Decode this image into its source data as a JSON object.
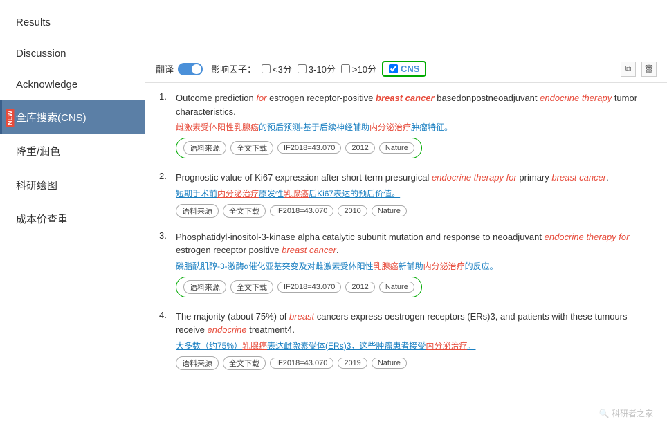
{
  "sidebar": {
    "items": [
      {
        "id": "results",
        "label": "Results",
        "active": false
      },
      {
        "id": "discussion",
        "label": "Discussion",
        "active": false
      },
      {
        "id": "acknowledge",
        "label": "Acknowledge",
        "active": false
      },
      {
        "id": "full-search",
        "label": "全库搜索(CNS)",
        "active": true,
        "badge": "NEW"
      },
      {
        "id": "weight-color",
        "label": "降重/润色",
        "active": false
      },
      {
        "id": "research-chart",
        "label": "科研绘图",
        "active": false
      },
      {
        "id": "cost-check",
        "label": "成本价查重",
        "active": false
      }
    ]
  },
  "toolbar": {
    "translate_label": "翻译",
    "filter_label": "影响因子：",
    "filter_lt3": "<3分",
    "filter_3_10": "3-10分",
    "filter_gt10": ">10分",
    "cns_label": "CNS",
    "icon_copy": "⧉",
    "icon_delete": "🗑"
  },
  "results": [
    {
      "index": 1,
      "title_parts": [
        {
          "text": "Outcome prediction ",
          "style": "normal"
        },
        {
          "text": "for",
          "style": "italic-red"
        },
        {
          "text": " estrogen receptor-positive ",
          "style": "normal"
        },
        {
          "text": "breast cancer",
          "style": "bold-italic-red"
        },
        {
          "text": " basedonpostneoadjuvant ",
          "style": "normal"
        },
        {
          "text": "endocrine therapy",
          "style": "italic-red"
        },
        {
          "text": " tumor characteristics.",
          "style": "normal"
        }
      ],
      "cn_text": "雌激素受体阳性乳腺癌的预后预测-基于后续神经辅助内分泌治疗肿瘤特征。",
      "cn_parts": [
        {
          "text": "雌激素受体阳性",
          "style": "red-underline"
        },
        {
          "text": "乳腺癌",
          "style": "red-underline"
        },
        {
          "text": "的预后预测-基于后续神经辅助",
          "style": "blue-underline"
        },
        {
          "text": "内分泌治疗",
          "style": "red-underline"
        },
        {
          "text": "肿瘤特征。",
          "style": "blue-underline"
        }
      ],
      "tags": [
        "语料来源",
        "全文下载",
        "IF2018=43.070",
        "2012",
        "Nature"
      ],
      "has_green_border": true
    },
    {
      "index": 2,
      "title_parts": [
        {
          "text": "Prognostic value of Ki67 expression after short-term presurgical ",
          "style": "normal"
        },
        {
          "text": "endocrine therapy for",
          "style": "italic-red"
        },
        {
          "text": " primary ",
          "style": "normal"
        },
        {
          "text": "breast cancer",
          "style": "italic-red"
        },
        {
          "text": ".",
          "style": "normal"
        }
      ],
      "cn_text": "短期手术前内分泌治疗原发性乳腺癌后Ki67表达的预后价值。",
      "cn_parts": [
        {
          "text": "短期手术前",
          "style": "blue-underline"
        },
        {
          "text": "内分泌治疗",
          "style": "red-underline"
        },
        {
          "text": "原发性",
          "style": "blue-underline"
        },
        {
          "text": "乳腺癌",
          "style": "red-underline"
        },
        {
          "text": "后Ki67表达的预后价值。",
          "style": "blue-underline"
        }
      ],
      "tags": [
        "语料来源",
        "全文下载",
        "IF2018=43.070",
        "2010",
        "Nature"
      ],
      "has_green_border": false
    },
    {
      "index": 3,
      "title_parts": [
        {
          "text": "Phosphatidyl-inositol-3-kinase alpha catalytic subunit mutation and response to neoadjuvant ",
          "style": "normal"
        },
        {
          "text": "endocrine therapy for",
          "style": "italic-red"
        },
        {
          "text": " estrogen receptor positive ",
          "style": "normal"
        },
        {
          "text": "breast cancer",
          "style": "italic-red"
        },
        {
          "text": ".",
          "style": "normal"
        }
      ],
      "cn_text": "磷脂酰肌醇-3-激酶α催化亚基突变及对雌激素受体阳性乳腺癌新辅助内分泌治疗的反应。",
      "cn_parts": [
        {
          "text": "磷脂酰肌醇-3-激酶α催化亚基突变及对雌激素受体阳性",
          "style": "blue-underline"
        },
        {
          "text": "乳腺癌",
          "style": "red-underline"
        },
        {
          "text": "新辅助",
          "style": "blue-underline"
        },
        {
          "text": "内分泌治疗",
          "style": "red-underline"
        },
        {
          "text": "的反应。",
          "style": "blue-underline"
        }
      ],
      "tags": [
        "语料来源",
        "全文下载",
        "IF2018=43.070",
        "2012",
        "Nature"
      ],
      "has_green_border": true
    },
    {
      "index": 4,
      "title_parts": [
        {
          "text": "The majority (about 75%) of ",
          "style": "normal"
        },
        {
          "text": "breast",
          "style": "italic-red"
        },
        {
          "text": " cancers express oestrogen receptors (ERs)3, and patients with these tumours receive ",
          "style": "normal"
        },
        {
          "text": "endocrine",
          "style": "italic-red"
        },
        {
          "text": " treatment4.",
          "style": "normal"
        }
      ],
      "cn_text": "大多数（约75%）乳腺癌表达雌激素受体(ERs)3，这些肿瘤患者接受内分泌治疗。",
      "cn_parts": [
        {
          "text": "大多数（约75%）",
          "style": "blue-underline"
        },
        {
          "text": "乳腺癌",
          "style": "red-underline"
        },
        {
          "text": "表达雌激素受体(ERs)3，这些肿瘤患者接受",
          "style": "blue-underline"
        },
        {
          "text": "内分泌治疗",
          "style": "red-underline"
        },
        {
          "text": "。",
          "style": "blue-underline"
        }
      ],
      "tags": [
        "语料来源",
        "全文下载",
        "IF2018=43.070",
        "2019",
        "Nature"
      ],
      "has_green_border": false
    }
  ],
  "watermark": {
    "text": "🔍 科研者之家"
  }
}
